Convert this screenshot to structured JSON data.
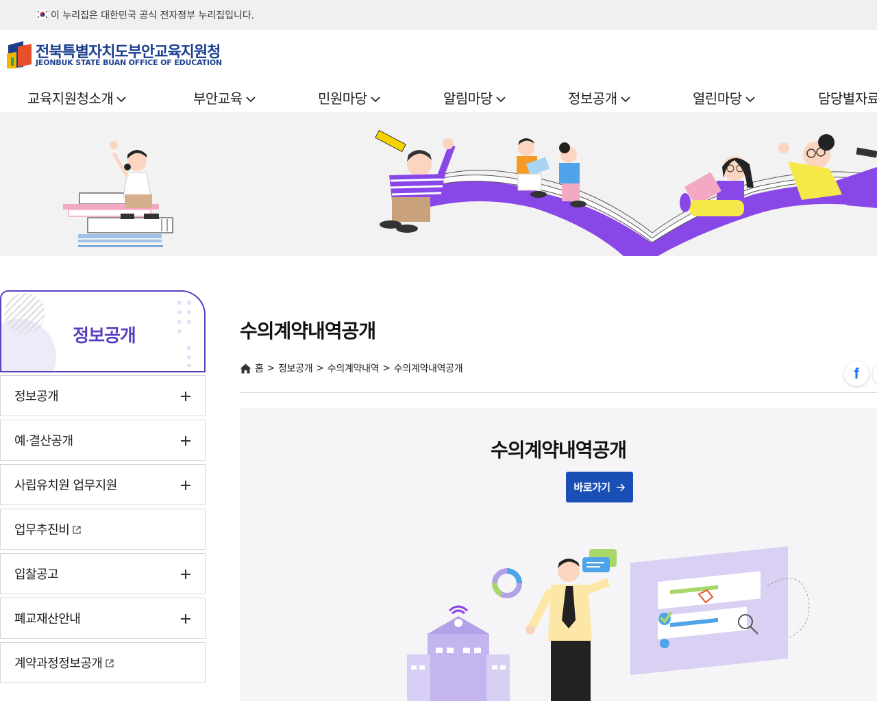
{
  "gov_banner": {
    "text": "이 누리집은 대한민국 공식 전자정부 누리집입니다."
  },
  "header": {
    "logo_name": "전북특별자치도부안교육지원청",
    "logo_eng": "JEONBUK STATE BUAN OFFICE OF EDUCATION"
  },
  "gnb": {
    "items": [
      {
        "label": "교육지원청소개"
      },
      {
        "label": "부안교육"
      },
      {
        "label": "민원마당"
      },
      {
        "label": "알림마당"
      },
      {
        "label": "정보공개"
      },
      {
        "label": "열린마당"
      },
      {
        "label": "담당별자료"
      }
    ]
  },
  "side": {
    "title": "정보공개",
    "items": [
      {
        "label": "정보공개",
        "icon": "plus-icon"
      },
      {
        "label": "예·결산공개",
        "icon": "plus-icon"
      },
      {
        "label": "사립유치원 업무지원",
        "icon": "plus-icon"
      },
      {
        "label": "업무추진비",
        "icon": "external-link-icon"
      },
      {
        "label": "입찰공고",
        "icon": "plus-icon"
      },
      {
        "label": "폐교재산안내",
        "icon": "plus-icon"
      },
      {
        "label": "계약과정정보공개",
        "icon": "external-link-icon"
      }
    ]
  },
  "content": {
    "page_title": "수의계약내역공개",
    "breadcrumb": [
      "홈",
      ">",
      "정보공개",
      ">",
      "수의계약내역",
      ">",
      "수의계약내역공개"
    ],
    "box_title": "수의계약내역공개",
    "go_button": "바로가기",
    "share": {
      "facebook": "f"
    }
  },
  "colors": {
    "brand_blue": "#1b3f8f",
    "accent_purple": "#5a3fc0",
    "button_blue": "#1a4fb6"
  }
}
